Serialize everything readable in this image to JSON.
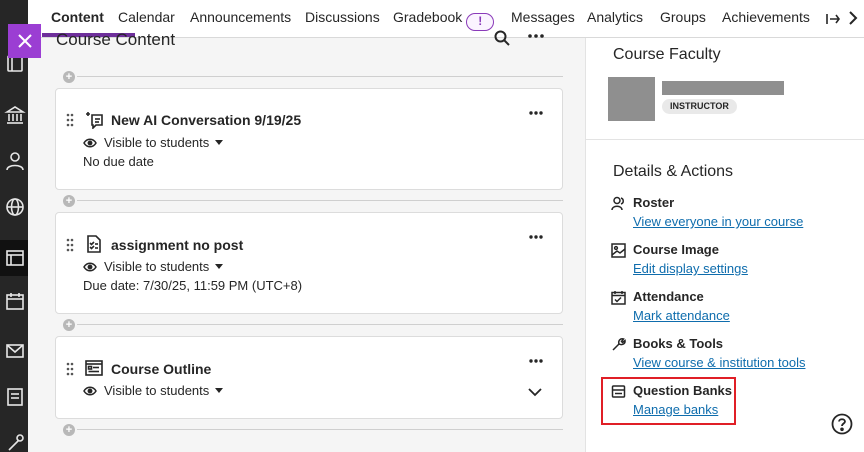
{
  "nav": {
    "tabs": [
      {
        "label": "Content"
      },
      {
        "label": "Calendar"
      },
      {
        "label": "Announcements"
      },
      {
        "label": "Discussions"
      },
      {
        "label": "Gradebook"
      },
      {
        "label": "Messages"
      },
      {
        "label": "Analytics"
      },
      {
        "label": "Groups"
      },
      {
        "label": "Achievements"
      }
    ],
    "gradebook_badge": "!"
  },
  "content": {
    "title": "Course Content",
    "items": [
      {
        "title": "New AI Conversation 9/19/25",
        "visibility": "Visible to students",
        "detail": "No due date",
        "icon": "ai-conversation-icon"
      },
      {
        "title": "assignment no post",
        "visibility": "Visible to students",
        "detail": "Due date: 7/30/25, 11:59 PM (UTC+8)",
        "icon": "assignment-icon"
      },
      {
        "title": "Course Outline",
        "visibility": "Visible to students",
        "icon": "document-icon"
      }
    ]
  },
  "panel": {
    "faculty_heading": "Course Faculty",
    "faculty_role": "INSTRUCTOR",
    "details_heading": "Details & Actions",
    "actions": [
      {
        "label": "Roster",
        "link": "View everyone in your course",
        "icon": "roster-icon"
      },
      {
        "label": "Course Image",
        "link": "Edit display settings",
        "icon": "image-icon"
      },
      {
        "label": "Attendance",
        "link": "Mark attendance",
        "icon": "attendance-icon"
      },
      {
        "label": "Books & Tools",
        "link": "View course & institution tools",
        "icon": "wrench-icon"
      },
      {
        "label": "Question Banks",
        "link": "Manage banks",
        "icon": "question-bank-icon"
      }
    ]
  },
  "colors": {
    "accent_purple": "#9b3ed3",
    "link_blue": "#0f6dad",
    "highlight_red": "#e01f26",
    "rail_dark": "#262626"
  }
}
